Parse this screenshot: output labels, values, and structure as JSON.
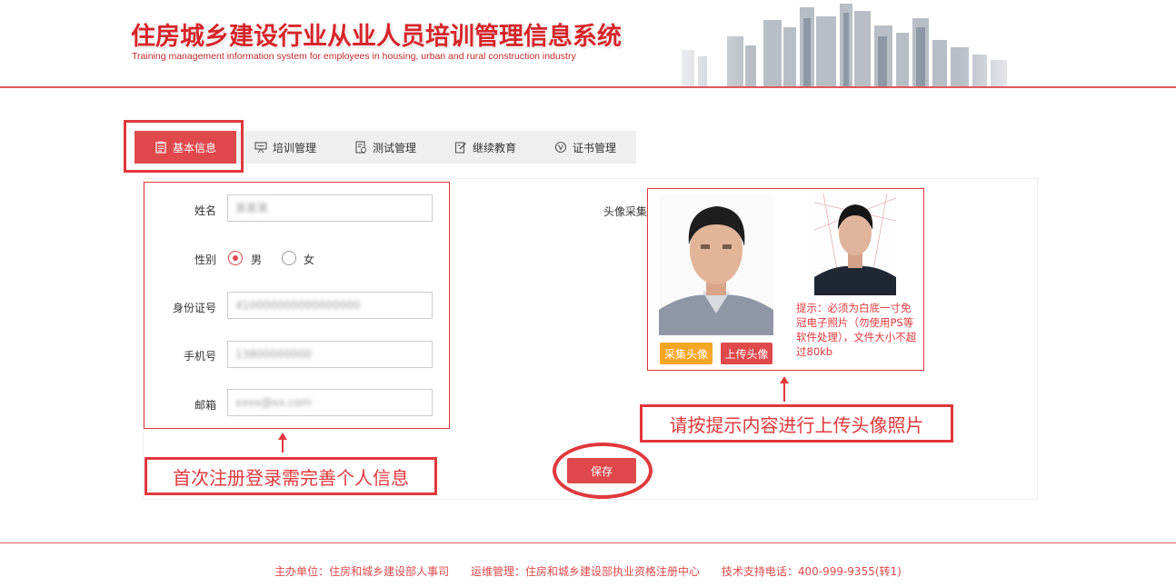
{
  "header": {
    "title": "住房城乡建设行业从业人员培训管理信息系统",
    "subtitle": "Training management information system for employees in housing, urban and rural construction industry"
  },
  "tabs": [
    {
      "label": "基本信息",
      "icon": "clipboard-icon",
      "active": true
    },
    {
      "label": "培训管理",
      "icon": "presentation-icon",
      "active": false
    },
    {
      "label": "测试管理",
      "icon": "test-doc-icon",
      "active": false
    },
    {
      "label": "继续教育",
      "icon": "edit-icon",
      "active": false
    },
    {
      "label": "证书管理",
      "icon": "certificate-icon",
      "active": false
    }
  ],
  "form": {
    "name_label": "姓名",
    "name_value": "某某某",
    "gender_label": "性别",
    "gender_options": [
      "男",
      "女"
    ],
    "gender_selected": "男",
    "id_label": "身份证号",
    "id_value": "410000000000000000",
    "phone_label": "手机号",
    "phone_value": "13800000000",
    "email_label": "邮箱",
    "email_value": "xxxx@xx.com"
  },
  "avatar": {
    "label": "头像采集",
    "capture_button": "采集头像",
    "upload_button": "上传头像",
    "hint": "提示：必须为白底一寸免冠电子照片（勿使用PS等软件处理），文件大小不超过80kb"
  },
  "annotations": {
    "form_callout": "首次注册登录需完善个人信息",
    "avatar_callout": "请按提示内容进行上传头像照片"
  },
  "save_button": "保存",
  "footer": {
    "sponsor": "主办单位：住房和城乡建设部人事司",
    "ops": "运维管理：住房和城乡建设部执业资格注册中心",
    "support": "技术支持电话：400-999-9355(转1)"
  },
  "colors": {
    "accent": "#e0494c",
    "annotation_red": "#e0383c",
    "capture_button": "#f5a623",
    "tab_bar": "#efefef"
  }
}
